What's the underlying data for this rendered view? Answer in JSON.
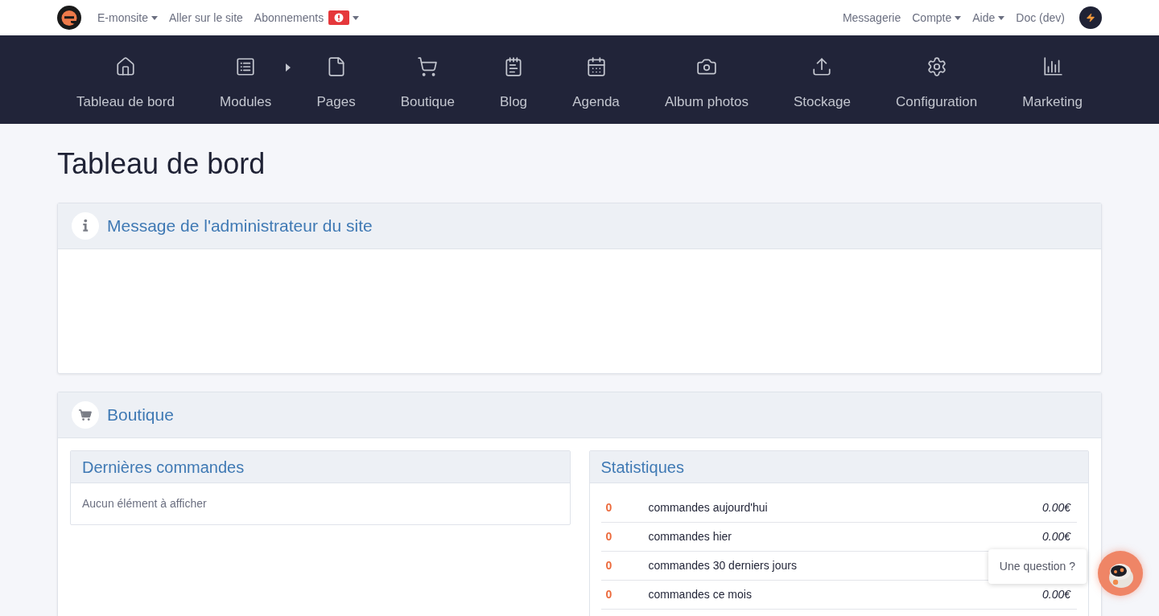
{
  "topbar": {
    "left": [
      {
        "label": "E-monsite",
        "dropdown": true,
        "alert": false
      },
      {
        "label": "Aller sur le site",
        "dropdown": false,
        "alert": false
      },
      {
        "label": "Abonnements",
        "dropdown": true,
        "alert": true
      }
    ],
    "right": [
      {
        "label": "Messagerie",
        "dropdown": false
      },
      {
        "label": "Compte",
        "dropdown": true
      },
      {
        "label": "Aide",
        "dropdown": true
      },
      {
        "label": "Doc (dev)",
        "dropdown": false
      }
    ]
  },
  "nav": [
    {
      "label": "Tableau de bord",
      "submenu": false
    },
    {
      "label": "Modules",
      "submenu": true
    },
    {
      "label": "Pages",
      "submenu": false
    },
    {
      "label": "Boutique",
      "submenu": false
    },
    {
      "label": "Blog",
      "submenu": false
    },
    {
      "label": "Agenda",
      "submenu": false
    },
    {
      "label": "Album photos",
      "submenu": false
    },
    {
      "label": "Stockage",
      "submenu": false
    },
    {
      "label": "Configuration",
      "submenu": false
    },
    {
      "label": "Marketing",
      "submenu": false
    }
  ],
  "page_title": "Tableau de bord",
  "admin_message": {
    "title": "Message de l'administrateur du site"
  },
  "shop": {
    "title": "Boutique",
    "latest_orders": {
      "title": "Dernières commandes",
      "empty_text": "Aucun élément à afficher"
    },
    "statistics": {
      "title": "Statistiques",
      "rows": [
        {
          "count": "0",
          "label": "commandes aujourd'hui",
          "amount": "0.00€"
        },
        {
          "count": "0",
          "label": "commandes hier",
          "amount": "0.00€"
        },
        {
          "count": "0",
          "label": "commandes 30 derniers jours"
        },
        {
          "count": "0",
          "label": "commandes ce mois",
          "amount": "0.00€"
        }
      ]
    }
  },
  "chat": {
    "tooltip": "Une question ?"
  }
}
